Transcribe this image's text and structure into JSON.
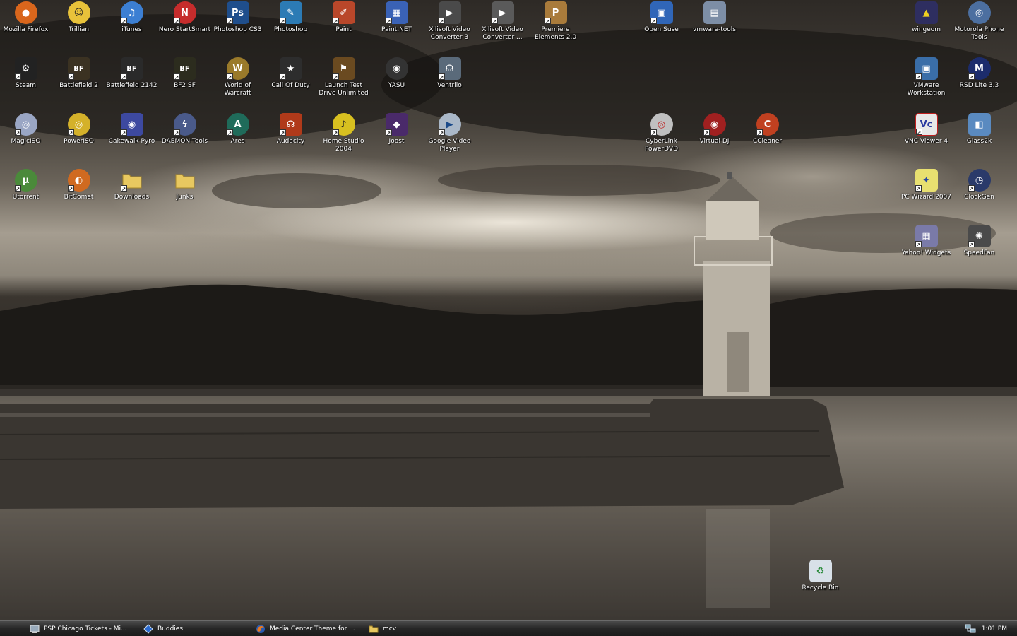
{
  "desktop": {
    "icons": [
      {
        "label": "Mozilla Firefox",
        "icon": "firefox-icon",
        "color": "#d9661c",
        "glyph": "●"
      },
      {
        "label": "Trillian",
        "icon": "trillian-icon",
        "color": "#e8c23a",
        "glyph": "☺"
      },
      {
        "label": "iTunes",
        "icon": "itunes-icon",
        "color": "#3c7fd3",
        "glyph": "♫"
      },
      {
        "label": "Nero StartSmart",
        "icon": "nero-icon",
        "color": "#c62c2c",
        "glyph": "N"
      },
      {
        "label": "Photoshop CS3",
        "icon": "photoshop-icon",
        "color": "#1f4e8c",
        "glyph": "Ps"
      },
      {
        "label": "Photoshop",
        "icon": "photoshop-feather-icon",
        "color": "#2c7bb5",
        "glyph": "✎"
      },
      {
        "label": "Paint",
        "icon": "paint-icon",
        "color": "#b9472a",
        "glyph": "✐"
      },
      {
        "label": "Paint.NET",
        "icon": "paintnet-icon",
        "color": "#3a62b6",
        "glyph": "▦"
      },
      {
        "label": "Xilisoft Video Converter 3",
        "icon": "video-converter-icon",
        "color": "#4a4a4a",
        "glyph": "▶"
      },
      {
        "label": "Xilisoft Video Converter ...",
        "icon": "video-converter-icon",
        "color": "#5a5a5a",
        "glyph": "▶"
      },
      {
        "label": "Premiere Elements 2.0",
        "icon": "premiere-icon",
        "color": "#a97b3b",
        "glyph": "P"
      },
      {
        "label": "Open Suse",
        "icon": "open-suse-icon",
        "color": "#3066b8",
        "glyph": "▣"
      },
      {
        "label": "vmware-tools",
        "icon": "vmware-tools-icon",
        "color": "#7d8ea6",
        "glyph": "▤"
      },
      {
        "label": "wingeom",
        "icon": "wingeom-icon",
        "color": "#2e2e60",
        "glyph": "▲"
      },
      {
        "label": "Motorola Phone Tools",
        "icon": "motorola-icon",
        "color": "#4c6fa0",
        "glyph": "◎"
      },
      {
        "label": "Steam",
        "icon": "steam-icon",
        "color": "#222",
        "glyph": "⚙"
      },
      {
        "label": "Battlefield 2",
        "icon": "battlefield-icon",
        "color": "#3b3222",
        "glyph": "BF"
      },
      {
        "label": "Battlefield 2142",
        "icon": "battlefield-2142-icon",
        "color": "#2a2a2a",
        "glyph": "BF"
      },
      {
        "label": "BF2 SF",
        "icon": "bf2sf-icon",
        "color": "#2c2c1e",
        "glyph": "BF"
      },
      {
        "label": "World of Warcraft",
        "icon": "warcraft-icon",
        "color": "#9a7a2a",
        "glyph": "W"
      },
      {
        "label": "Call Of Duty",
        "icon": "call-of-duty-icon",
        "color": "#2d2d2d",
        "glyph": "★"
      },
      {
        "label": "Launch Test Drive Unlimited",
        "icon": "test-drive-icon",
        "color": "#6a4a20",
        "glyph": "⚑"
      },
      {
        "label": "YASU",
        "icon": "yasu-icon",
        "color": "#333",
        "glyph": "◉"
      },
      {
        "label": "Ventrilo",
        "icon": "ventrilo-icon",
        "color": "#5a6a7a",
        "glyph": "☊"
      },
      {
        "label": "VMware Workstation",
        "icon": "vmware-icon",
        "color": "#3a6ea8",
        "glyph": "▣"
      },
      {
        "label": "RSD Lite 3.3",
        "icon": "rsd-lite-icon",
        "color": "#1c2c6c",
        "glyph": "M"
      },
      {
        "label": "MagicISO",
        "icon": "magiciso-icon",
        "color": "#9aa6c4",
        "glyph": "◎"
      },
      {
        "label": "PowerISO",
        "icon": "poweriso-icon",
        "color": "#d4b12a",
        "glyph": "◎"
      },
      {
        "label": "Cakewalk Pyro",
        "icon": "cakewalk-icon",
        "color": "#3d49a0",
        "glyph": "◉"
      },
      {
        "label": "DAEMON Tools",
        "icon": "daemon-tools-icon",
        "color": "#4a5a8a",
        "glyph": "ϟ"
      },
      {
        "label": "Ares",
        "icon": "ares-icon",
        "color": "#1f6b5a",
        "glyph": "A"
      },
      {
        "label": "Audacity",
        "icon": "audacity-icon",
        "color": "#b03a1a",
        "glyph": "☊"
      },
      {
        "label": "Home Studio 2004",
        "icon": "home-studio-icon",
        "color": "#d8c020",
        "glyph": "♪"
      },
      {
        "label": "Joost",
        "icon": "joost-icon",
        "color": "#4a2a6a",
        "glyph": "◆"
      },
      {
        "label": "Google Video Player",
        "icon": "google-video-icon",
        "color": "#aab8c8",
        "glyph": "▶"
      },
      {
        "label": "CyberLink PowerDVD",
        "icon": "powerdvd-icon",
        "color": "#c0c0c0",
        "glyph": "◎"
      },
      {
        "label": "Virtual DJ",
        "icon": "virtual-dj-icon",
        "color": "#a02020",
        "glyph": "◉"
      },
      {
        "label": "CCleaner",
        "icon": "ccleaner-icon",
        "color": "#c04020",
        "glyph": "C"
      },
      {
        "label": "VNC Viewer 4",
        "icon": "vnc-icon",
        "color": "#e8e8e8",
        "glyph": "Vc"
      },
      {
        "label": "Glass2k",
        "icon": "glass2k-icon",
        "color": "#5a8ac0",
        "glyph": "◧"
      },
      {
        "label": "Utorrent",
        "icon": "utorrent-icon",
        "color": "#4a8a3a",
        "glyph": "µ"
      },
      {
        "label": "BitComet",
        "icon": "bitcomet-icon",
        "color": "#d06a20",
        "glyph": "◐"
      },
      {
        "label": "Downloads",
        "icon": "folder-icon",
        "color": "#e8c860",
        "glyph": ""
      },
      {
        "label": "Junks",
        "icon": "folder-icon",
        "color": "#e8c860",
        "glyph": ""
      },
      {
        "label": "PC Wizard 2007",
        "icon": "pc-wizard-icon",
        "color": "#e8e070",
        "glyph": "✦"
      },
      {
        "label": "ClockGen",
        "icon": "clockgen-icon",
        "color": "#2a3a6a",
        "glyph": "◷"
      },
      {
        "label": "Yahoo! Widgets",
        "icon": "yahoo-widgets-icon",
        "color": "#7a7aa8",
        "glyph": "▦"
      },
      {
        "label": "SpeedFan",
        "icon": "speedfan-icon",
        "color": "#4a4a4a",
        "glyph": "✺"
      },
      {
        "label": "Recycle Bin",
        "icon": "recycle-bin-icon",
        "color": "#d8e0e8",
        "glyph": "♻"
      }
    ]
  },
  "taskbar": {
    "tasks": [
      {
        "label": "PSP Chicago Tickets - Mi...",
        "icon": "messenger-icon"
      },
      {
        "label": "Buddies",
        "icon": "buddies-icon"
      },
      {
        "label": "Media Center Theme for ...",
        "icon": "firefox-icon"
      },
      {
        "label": "mcv",
        "icon": "folder-icon"
      }
    ],
    "tray": {
      "network_icon": "network-icon",
      "clock": "1:01 PM"
    }
  }
}
